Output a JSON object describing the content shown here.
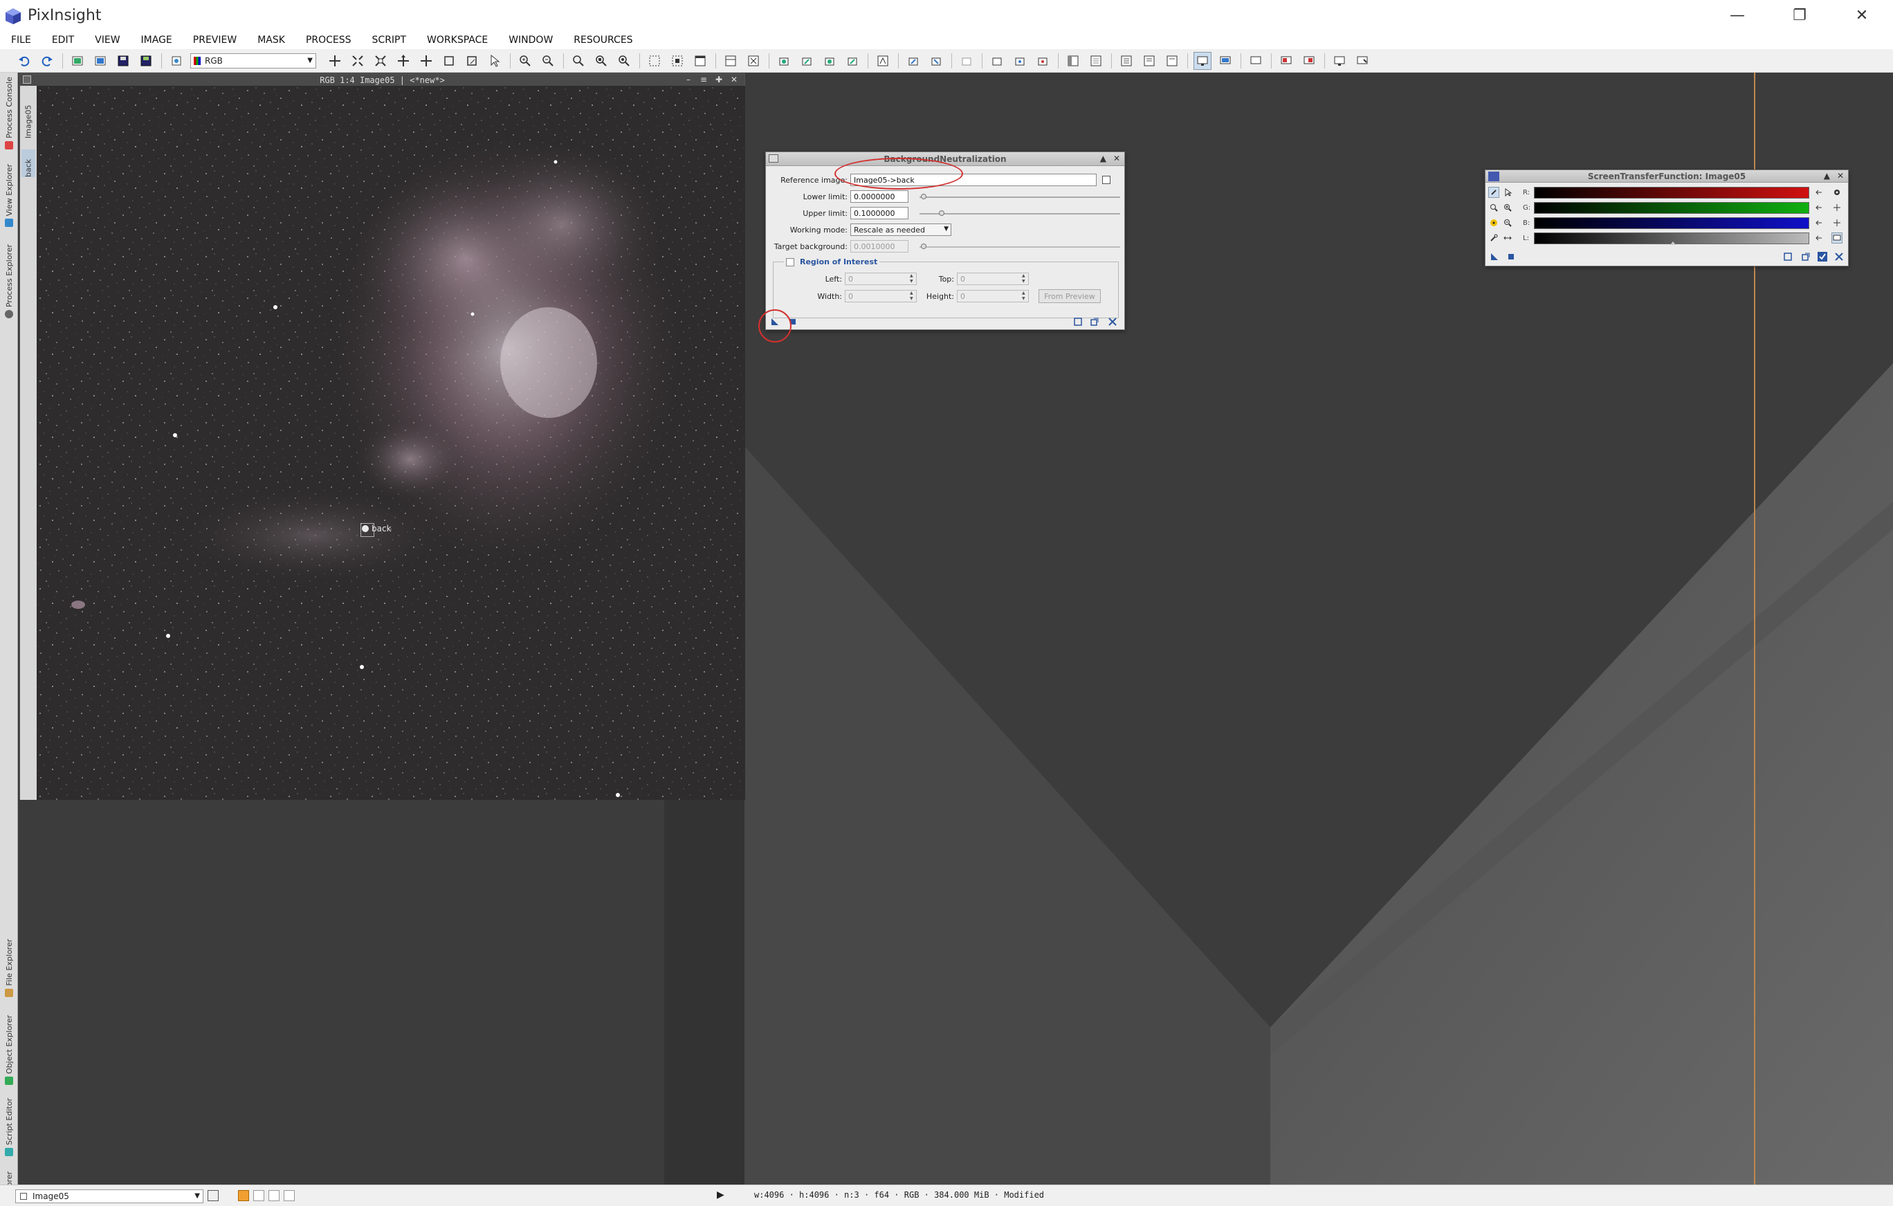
{
  "app": {
    "title": "PixInsight",
    "window_controls": [
      "minimize",
      "restore",
      "close"
    ]
  },
  "menu": [
    "FILE",
    "EDIT",
    "VIEW",
    "IMAGE",
    "PREVIEW",
    "MASK",
    "PROCESS",
    "SCRIPT",
    "WORKSPACE",
    "WINDOW",
    "RESOURCES"
  ],
  "toolbar": {
    "channel_select": "RGB"
  },
  "side_panel_tabs": [
    "Process Console",
    "View Explorer",
    "Process Explorer",
    "File Explorer",
    "Object Explorer",
    "Script Editor",
    "History Explorer"
  ],
  "image_window": {
    "title": "RGB 1:4 Image05 | <*new*>",
    "left_tabs": [
      "Image05",
      "back"
    ],
    "preview_label": "back"
  },
  "bn_dialog": {
    "title": "BackgroundNeutralization",
    "reference_image_label": "Reference image:",
    "reference_image_value": "Image05->back",
    "lower_limit_label": "Lower limit:",
    "lower_limit_value": "0.0000000",
    "upper_limit_label": "Upper limit:",
    "upper_limit_value": "0.1000000",
    "working_mode_label": "Working mode:",
    "working_mode_value": "Rescale as needed",
    "target_background_label": "Target background:",
    "target_background_value": "0.0010000",
    "roi_title": "Region of Interest",
    "left_label": "Left:",
    "left_value": "0",
    "top_label": "Top:",
    "top_value": "0",
    "width_label": "Width:",
    "width_value": "0",
    "height_label": "Height:",
    "height_value": "0",
    "from_preview_label": "From Preview"
  },
  "stf_dialog": {
    "title": "ScreenTransferFunction: Image05",
    "channels": [
      "R:",
      "G:",
      "B:",
      "L:"
    ],
    "channel_colors": [
      "#d01010",
      "#10b010",
      "#1010c8",
      "#bbbbbb"
    ]
  },
  "statusbar": {
    "view_select": "Image05",
    "info": "w:4096 · h:4096 · n:3 · f64 · RGB · 384.000 MiB · Modified"
  }
}
